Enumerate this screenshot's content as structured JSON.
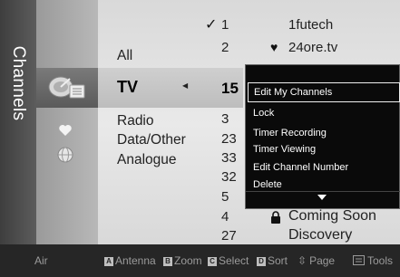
{
  "panel": {
    "title": "Channels"
  },
  "categories": [
    {
      "label": "All"
    },
    {
      "label": "TV",
      "selected": true
    },
    {
      "label": "Radio"
    },
    {
      "label": "Data/Other"
    },
    {
      "label": "Analogue"
    }
  ],
  "channels": [
    {
      "number": "1",
      "name": "1futech",
      "checked": true,
      "icon": ""
    },
    {
      "number": "2",
      "name": "24ore.tv",
      "icon": "heart-icon"
    },
    {
      "number": "15",
      "name": "",
      "selected": true
    },
    {
      "number": "3",
      "name": ""
    },
    {
      "number": "23",
      "name": ""
    },
    {
      "number": "33",
      "name": ""
    },
    {
      "number": "32",
      "name": ""
    },
    {
      "number": "5",
      "name": ""
    },
    {
      "number": "4",
      "name": "Coming Soon",
      "icon": "lock-icon"
    },
    {
      "number": "27",
      "name": "Discovery"
    }
  ],
  "tools_menu": {
    "items": [
      {
        "label": "Edit My Channels",
        "selected": true
      },
      {
        "label": "Lock"
      },
      {
        "label": "Timer Recording"
      },
      {
        "label": "Timer Viewing"
      },
      {
        "label": "Edit Channel Number"
      },
      {
        "label": "Delete"
      }
    ]
  },
  "bottom_bar": {
    "source": "Air",
    "keys": [
      {
        "key": "A",
        "label": "Antenna"
      },
      {
        "key": "B",
        "label": "Zoom"
      },
      {
        "key": "C",
        "label": "Select"
      },
      {
        "key": "D",
        "label": "Sort"
      },
      {
        "key": "",
        "label": "Page",
        "icon": "updown-icon"
      },
      {
        "key": "",
        "label": "Tools",
        "icon": "tools-icon"
      }
    ]
  }
}
